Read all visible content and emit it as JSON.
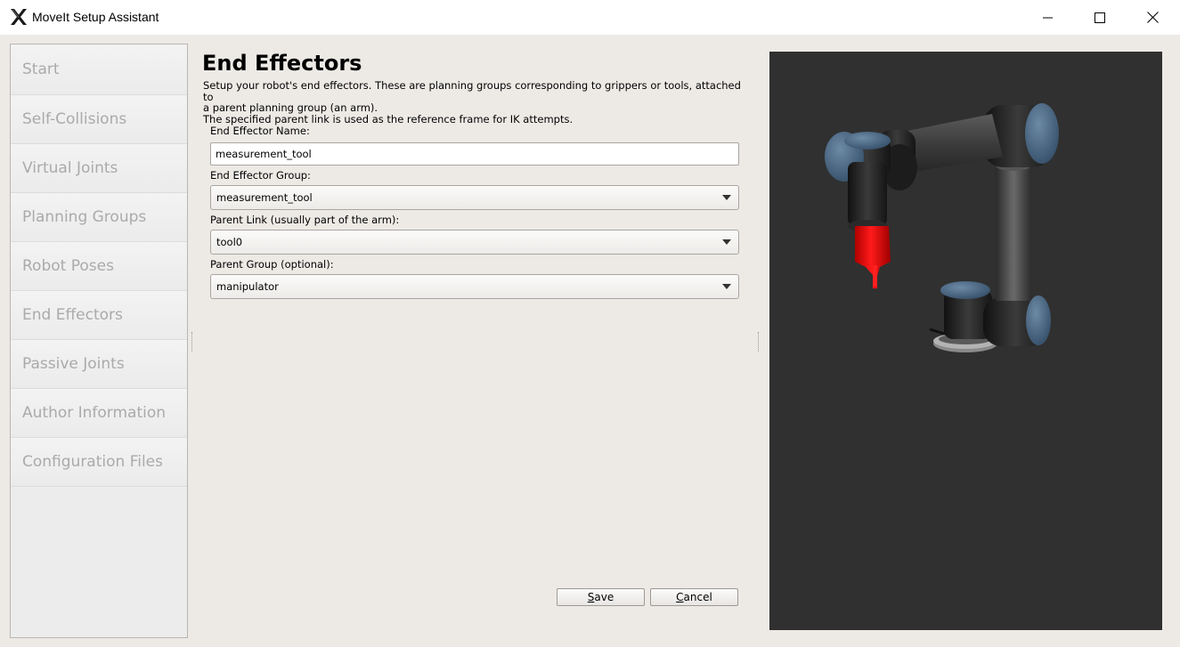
{
  "window": {
    "title": "MoveIt Setup Assistant",
    "icon": "x-logo-icon",
    "controls": [
      "minimize-icon",
      "maximize-icon",
      "close-icon"
    ]
  },
  "sidebar": {
    "items": [
      {
        "label": "Start"
      },
      {
        "label": "Self-Collisions"
      },
      {
        "label": "Virtual Joints"
      },
      {
        "label": "Planning Groups"
      },
      {
        "label": "Robot Poses"
      },
      {
        "label": "End Effectors"
      },
      {
        "label": "Passive Joints"
      },
      {
        "label": "Author Information"
      },
      {
        "label": "Configuration Files"
      }
    ]
  },
  "main": {
    "heading": "End Effectors",
    "description_line1": "Setup your robot's end effectors. These are planning groups corresponding to grippers or tools, attached to",
    "description_line2": "a parent planning group (an arm).",
    "description_line3": "The specified parent link is used as the reference frame for IK attempts.",
    "name_label": "End Effector Name:",
    "name_value": "measurement_tool",
    "group_label": "End Effector Group:",
    "group_value": "measurement_tool",
    "parent_link_label": "Parent Link (usually part of the arm):",
    "parent_link_value": "tool0",
    "parent_group_label": "Parent Group (optional):",
    "parent_group_value": "manipulator",
    "save_mnemonic": "S",
    "save_rest": "ave",
    "cancel_mnemonic": "C",
    "cancel_rest": "ancel"
  },
  "viewport": {
    "background": "#303030",
    "highlight_color": "#e00000",
    "joint_cap_color": "#4a6884"
  }
}
